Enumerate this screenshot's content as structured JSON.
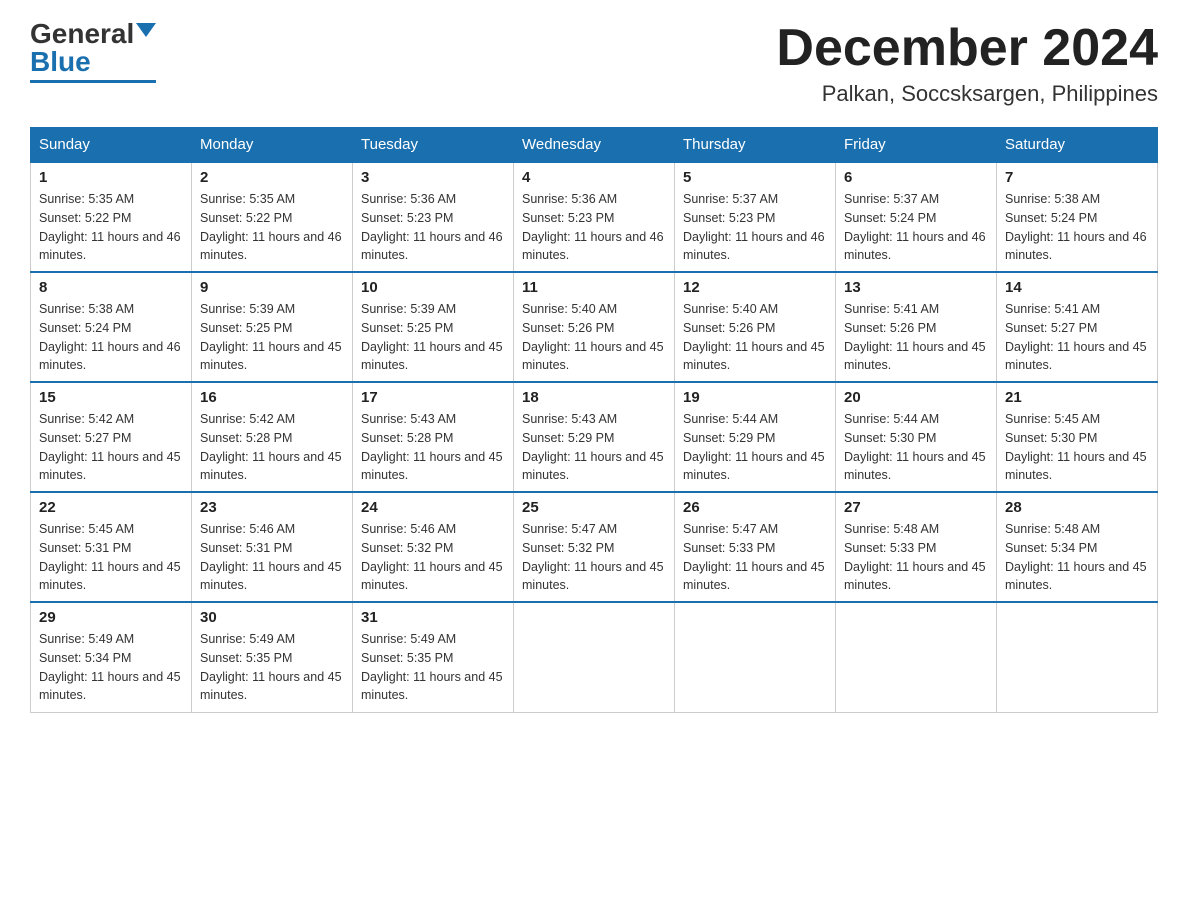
{
  "header": {
    "logo_general": "General",
    "logo_blue": "Blue",
    "month_title": "December 2024",
    "location": "Palkan, Soccsksargen, Philippines"
  },
  "days_of_week": [
    "Sunday",
    "Monday",
    "Tuesday",
    "Wednesday",
    "Thursday",
    "Friday",
    "Saturday"
  ],
  "weeks": [
    [
      {
        "day": "1",
        "sunrise": "5:35 AM",
        "sunset": "5:22 PM",
        "daylight": "11 hours and 46 minutes."
      },
      {
        "day": "2",
        "sunrise": "5:35 AM",
        "sunset": "5:22 PM",
        "daylight": "11 hours and 46 minutes."
      },
      {
        "day": "3",
        "sunrise": "5:36 AM",
        "sunset": "5:23 PM",
        "daylight": "11 hours and 46 minutes."
      },
      {
        "day": "4",
        "sunrise": "5:36 AM",
        "sunset": "5:23 PM",
        "daylight": "11 hours and 46 minutes."
      },
      {
        "day": "5",
        "sunrise": "5:37 AM",
        "sunset": "5:23 PM",
        "daylight": "11 hours and 46 minutes."
      },
      {
        "day": "6",
        "sunrise": "5:37 AM",
        "sunset": "5:24 PM",
        "daylight": "11 hours and 46 minutes."
      },
      {
        "day": "7",
        "sunrise": "5:38 AM",
        "sunset": "5:24 PM",
        "daylight": "11 hours and 46 minutes."
      }
    ],
    [
      {
        "day": "8",
        "sunrise": "5:38 AM",
        "sunset": "5:24 PM",
        "daylight": "11 hours and 46 minutes."
      },
      {
        "day": "9",
        "sunrise": "5:39 AM",
        "sunset": "5:25 PM",
        "daylight": "11 hours and 45 minutes."
      },
      {
        "day": "10",
        "sunrise": "5:39 AM",
        "sunset": "5:25 PM",
        "daylight": "11 hours and 45 minutes."
      },
      {
        "day": "11",
        "sunrise": "5:40 AM",
        "sunset": "5:26 PM",
        "daylight": "11 hours and 45 minutes."
      },
      {
        "day": "12",
        "sunrise": "5:40 AM",
        "sunset": "5:26 PM",
        "daylight": "11 hours and 45 minutes."
      },
      {
        "day": "13",
        "sunrise": "5:41 AM",
        "sunset": "5:26 PM",
        "daylight": "11 hours and 45 minutes."
      },
      {
        "day": "14",
        "sunrise": "5:41 AM",
        "sunset": "5:27 PM",
        "daylight": "11 hours and 45 minutes."
      }
    ],
    [
      {
        "day": "15",
        "sunrise": "5:42 AM",
        "sunset": "5:27 PM",
        "daylight": "11 hours and 45 minutes."
      },
      {
        "day": "16",
        "sunrise": "5:42 AM",
        "sunset": "5:28 PM",
        "daylight": "11 hours and 45 minutes."
      },
      {
        "day": "17",
        "sunrise": "5:43 AM",
        "sunset": "5:28 PM",
        "daylight": "11 hours and 45 minutes."
      },
      {
        "day": "18",
        "sunrise": "5:43 AM",
        "sunset": "5:29 PM",
        "daylight": "11 hours and 45 minutes."
      },
      {
        "day": "19",
        "sunrise": "5:44 AM",
        "sunset": "5:29 PM",
        "daylight": "11 hours and 45 minutes."
      },
      {
        "day": "20",
        "sunrise": "5:44 AM",
        "sunset": "5:30 PM",
        "daylight": "11 hours and 45 minutes."
      },
      {
        "day": "21",
        "sunrise": "5:45 AM",
        "sunset": "5:30 PM",
        "daylight": "11 hours and 45 minutes."
      }
    ],
    [
      {
        "day": "22",
        "sunrise": "5:45 AM",
        "sunset": "5:31 PM",
        "daylight": "11 hours and 45 minutes."
      },
      {
        "day": "23",
        "sunrise": "5:46 AM",
        "sunset": "5:31 PM",
        "daylight": "11 hours and 45 minutes."
      },
      {
        "day": "24",
        "sunrise": "5:46 AM",
        "sunset": "5:32 PM",
        "daylight": "11 hours and 45 minutes."
      },
      {
        "day": "25",
        "sunrise": "5:47 AM",
        "sunset": "5:32 PM",
        "daylight": "11 hours and 45 minutes."
      },
      {
        "day": "26",
        "sunrise": "5:47 AM",
        "sunset": "5:33 PM",
        "daylight": "11 hours and 45 minutes."
      },
      {
        "day": "27",
        "sunrise": "5:48 AM",
        "sunset": "5:33 PM",
        "daylight": "11 hours and 45 minutes."
      },
      {
        "day": "28",
        "sunrise": "5:48 AM",
        "sunset": "5:34 PM",
        "daylight": "11 hours and 45 minutes."
      }
    ],
    [
      {
        "day": "29",
        "sunrise": "5:49 AM",
        "sunset": "5:34 PM",
        "daylight": "11 hours and 45 minutes."
      },
      {
        "day": "30",
        "sunrise": "5:49 AM",
        "sunset": "5:35 PM",
        "daylight": "11 hours and 45 minutes."
      },
      {
        "day": "31",
        "sunrise": "5:49 AM",
        "sunset": "5:35 PM",
        "daylight": "11 hours and 45 minutes."
      },
      null,
      null,
      null,
      null
    ]
  ],
  "labels": {
    "sunrise_prefix": "Sunrise: ",
    "sunset_prefix": "Sunset: ",
    "daylight_prefix": "Daylight: "
  }
}
